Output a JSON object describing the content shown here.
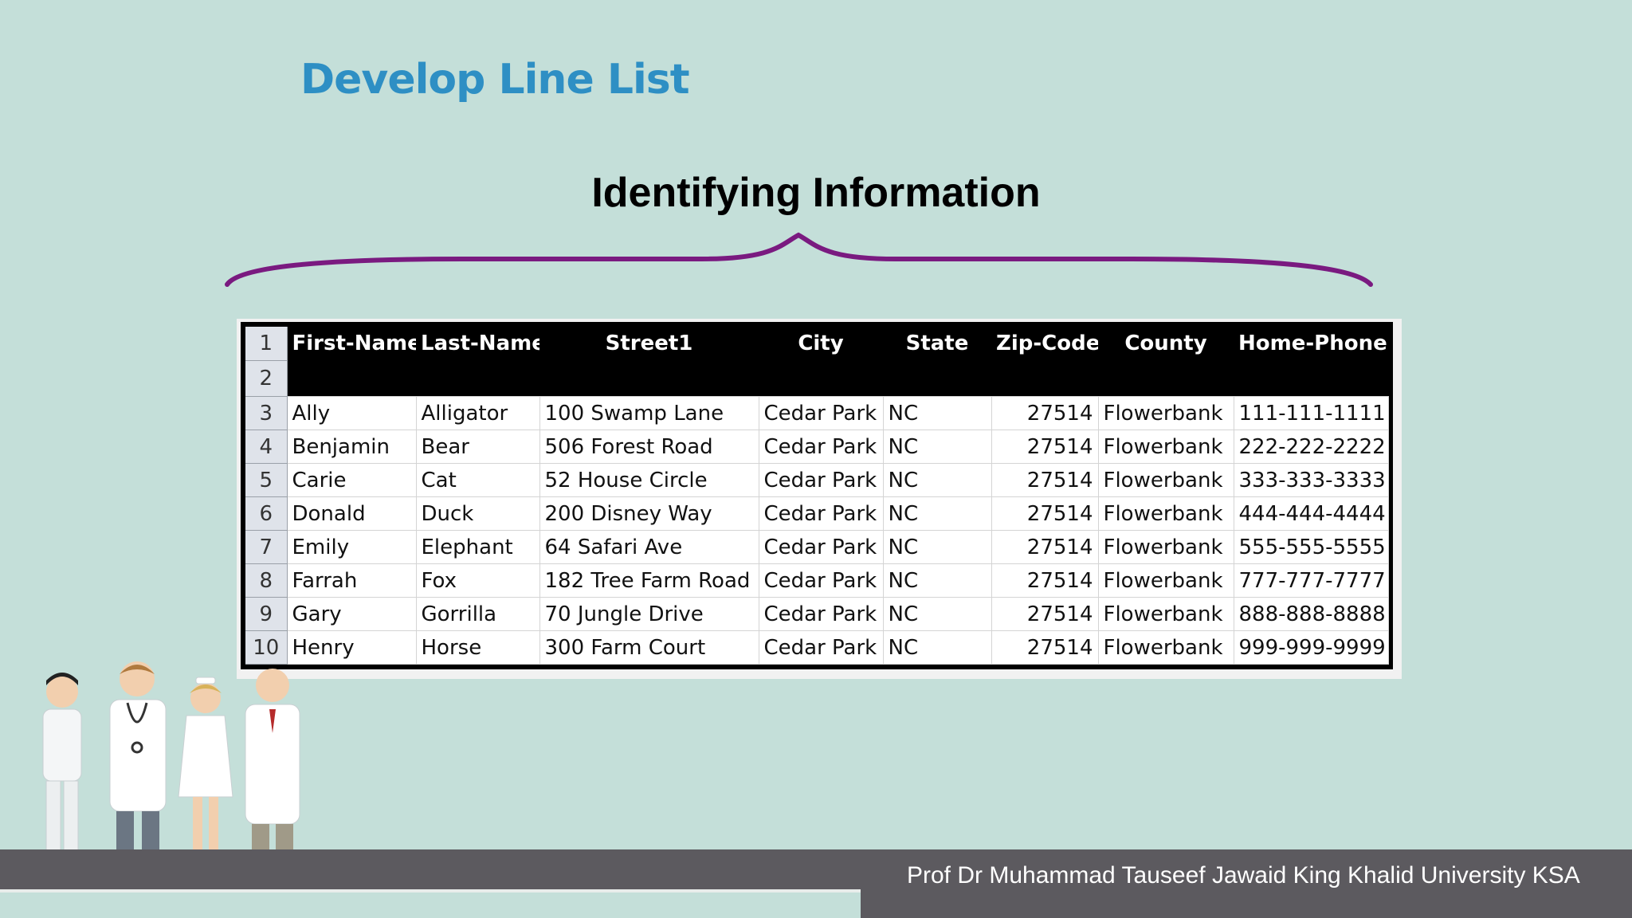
{
  "slide": {
    "title": "Develop Line List",
    "subtitle": "Identifying Information"
  },
  "table": {
    "columns": [
      "First-Name",
      "Last-Name",
      "Street1",
      "City",
      "State",
      "Zip-Code",
      "County",
      "Home-Phone"
    ],
    "header_row_numbers": [
      "1",
      "2"
    ],
    "rows": [
      {
        "n": "3",
        "cells": [
          "Ally",
          "Alligator",
          "100 Swamp Lane",
          "Cedar Park",
          "NC",
          "27514",
          "Flowerbank",
          "111-111-1111"
        ]
      },
      {
        "n": "4",
        "cells": [
          "Benjamin",
          "Bear",
          "506 Forest Road",
          "Cedar Park",
          "NC",
          "27514",
          "Flowerbank",
          "222-222-2222"
        ]
      },
      {
        "n": "5",
        "cells": [
          "Carie",
          "Cat",
          "52 House Circle",
          "Cedar Park",
          "NC",
          "27514",
          "Flowerbank",
          "333-333-3333"
        ]
      },
      {
        "n": "6",
        "cells": [
          "Donald",
          "Duck",
          "200 Disney Way",
          "Cedar Park",
          "NC",
          "27514",
          "Flowerbank",
          "444-444-4444"
        ]
      },
      {
        "n": "7",
        "cells": [
          "Emily",
          "Elephant",
          "64 Safari Ave",
          "Cedar Park",
          "NC",
          "27514",
          "Flowerbank",
          "555-555-5555"
        ]
      },
      {
        "n": "8",
        "cells": [
          "Farrah",
          "Fox",
          "182 Tree Farm Road",
          "Cedar Park",
          "NC",
          "27514",
          "Flowerbank",
          "777-777-7777"
        ]
      },
      {
        "n": "9",
        "cells": [
          "Gary",
          "Gorrilla",
          "70 Jungle Drive",
          "Cedar Park",
          "NC",
          "27514",
          "Flowerbank",
          "888-888-8888"
        ]
      },
      {
        "n": "10",
        "cells": [
          "Henry",
          "Horse",
          "300 Farm Court",
          "Cedar Park",
          "NC",
          "27514",
          "Flowerbank",
          "999-999-9999"
        ]
      }
    ]
  },
  "footer": {
    "text": "Prof Dr Muhammad Tauseef Jawaid King Khalid University KSA"
  },
  "colors": {
    "background": "#c4dfd9",
    "title": "#2e8fc4",
    "brace": "#7a1a80",
    "footer": "#5c5a5f"
  },
  "icons": {
    "illustration": "medical-staff-illustration",
    "brace": "curly-brace"
  }
}
